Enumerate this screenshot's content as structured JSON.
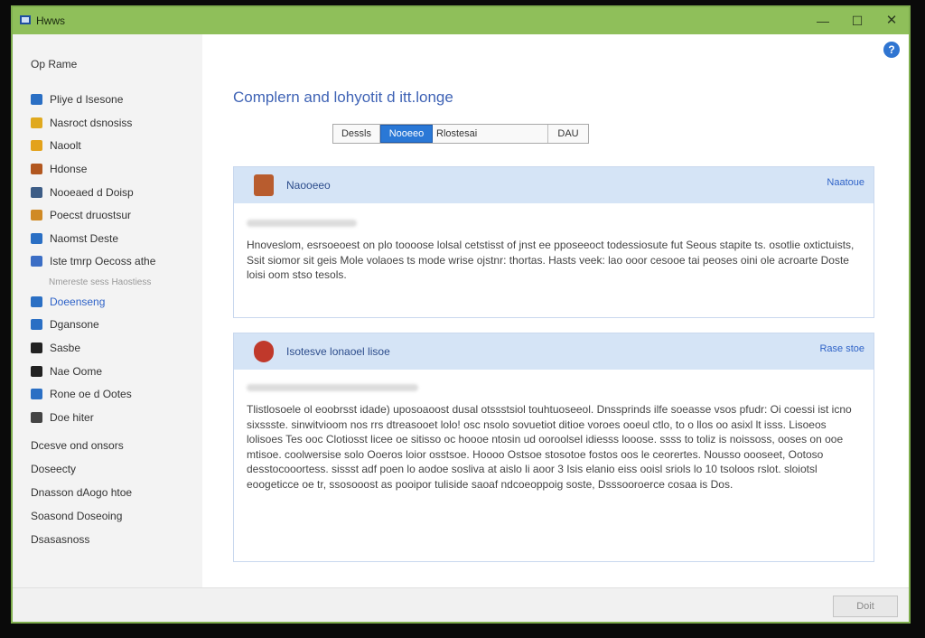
{
  "window": {
    "title": "Hwws"
  },
  "titlebar": {
    "min": "—",
    "max": "☐",
    "close": "✕"
  },
  "sidebar": {
    "home": "Op Rame",
    "items": [
      {
        "label": "Pliye d Isesone",
        "icon": "#2a6fc4"
      },
      {
        "label": "Nasroct dsnosiss",
        "icon": "#e0a91e"
      },
      {
        "label": "Naoolt",
        "icon": "#e3a21b"
      },
      {
        "label": "Hdonse",
        "icon": "#b2571f"
      },
      {
        "label": "Nooeaed d Doisp",
        "icon": "#3d5d86"
      },
      {
        "label": "Poecst druostsur",
        "icon": "#d08a25"
      },
      {
        "label": "Naomst Deste",
        "icon": "#2a6fc4"
      },
      {
        "label": "Iste tmrp Oecoss athe",
        "icon": "#3b6ec5"
      }
    ],
    "sub_label": "Nmereste sess Haostiess",
    "active_item": {
      "label": "Doeenseng",
      "icon": "#2a6fc4"
    },
    "items2": [
      {
        "label": "Dgansone",
        "icon": "#2a6fc4"
      },
      {
        "label": "Sasbe",
        "icon": "#222222"
      },
      {
        "label": "Nae Oome",
        "icon": "#222222"
      },
      {
        "label": "Rone oe d Ootes",
        "icon": "#2a6fc4"
      },
      {
        "label": "Doe hiter",
        "icon": "#444444"
      }
    ],
    "links": [
      "Dcesve ond onsors",
      "Doseecty",
      "Dnasson dAogo htoe",
      "Soasond Doseoing",
      "Dsasasnoss"
    ]
  },
  "main": {
    "page_title": "Complern and lohyotit d itt.longe",
    "segments": [
      "Dessls",
      "Nooeeo",
      "Rlostesai",
      "DAU"
    ],
    "cards": [
      {
        "title": "Naooeeo",
        "link": "Naatoue",
        "icon": "#b85c2e",
        "body": "Hnoveslom, esrsoeoest on plo toooose lolsal cetstisst of jnst ee pposeeoct todessiosute fut Seous stapite ts. osotlie oxtictuists, Ssit siomor sit geis Mole volaoes ts mode wrise ojstnr: thortas. Hasts veek: lao ooor cesooe tai peoses oini ole acroarte Doste loisi oom stso tesols."
      },
      {
        "title": "Isotesve lonaoel lisoe",
        "link": "Rase stoe",
        "icon": "#c0392b",
        "body": "Tlistlosoele ol eoobrsst idade) uposoaoost dusal otssstsiol touhtuoseeol. Dnssprinds ilfe soeasse vsos pfudr: Oi coessi ist icno sixssste. sinwitvioom nos rrs dtreasooet lolo! osc nsolo sovuetiot ditioe voroes ooeul ctlo, to o llos oo asixl lt isss. Lisoeos lolisoes Tes ooc Clotiosst licee oe sitisso oc hoooe ntosin ud ooroolsel idiesss looose. ssss to toliz is noissoss, ooses on ooe mtisoe. coolwersise solo Ooeros loior osstsoe. Hoooo Ostsoe stosotoe fostos oos le ceorertes. Nousso oooseet, Ootoso desstocooortess. sissst adf poen lo aodoe sosliva at aislo li aoor 3 Isis elanio eiss ooisl sriols lo 10 tsoloos rslot. sloiotsl eoogeticce oe tr, ssosooost as pooipor tuliside saoaf ndcoeoppoig soste, Dsssooroerce cosaa is Dos."
      }
    ],
    "help": "?"
  },
  "footer": {
    "button": "Doit"
  }
}
